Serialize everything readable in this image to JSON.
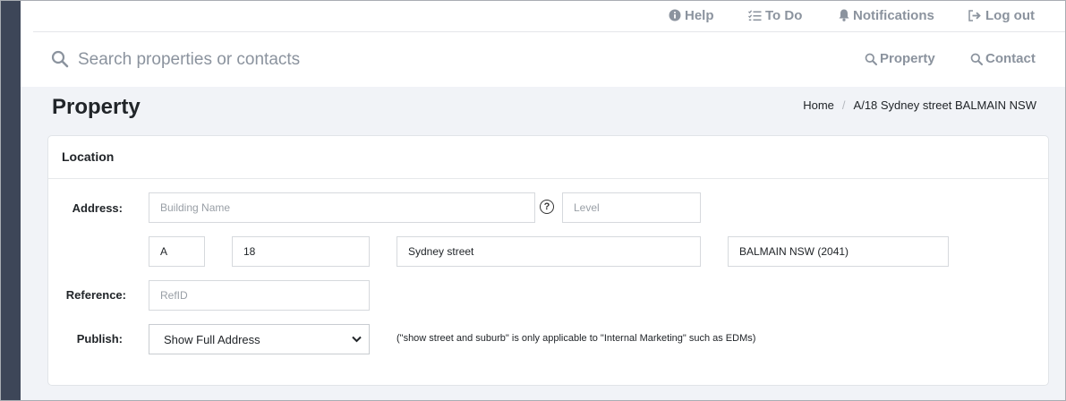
{
  "topnav": {
    "help": "Help",
    "todo": "To Do",
    "notifications": "Notifications",
    "logout": "Log out"
  },
  "search": {
    "placeholder": "Search properties or contacts",
    "property_link": "Property",
    "contact_link": "Contact"
  },
  "page": {
    "title": "Property",
    "breadcrumb": [
      "Home",
      "A/18 Sydney street BALMAIN NSW"
    ]
  },
  "card": {
    "title": "Location",
    "address_label": "Address:",
    "building_placeholder": "Building Name",
    "help_glyph": "?",
    "level_placeholder": "Level",
    "unit_value": "A",
    "number_value": "18",
    "street_value": "Sydney street",
    "suburb_value": "BALMAIN NSW (2041)",
    "reference_label": "Reference:",
    "refid_placeholder": "RefID",
    "publish_label": "Publish:",
    "publish_selected": "Show Full Address",
    "publish_note": "(\"show street and suburb\" is only applicable to \"Internal Marketing\" such as EDMs)"
  },
  "colors": {
    "sidebar": "#3d4658",
    "nav_text": "#8b939e",
    "band": "#f1f3f7"
  }
}
